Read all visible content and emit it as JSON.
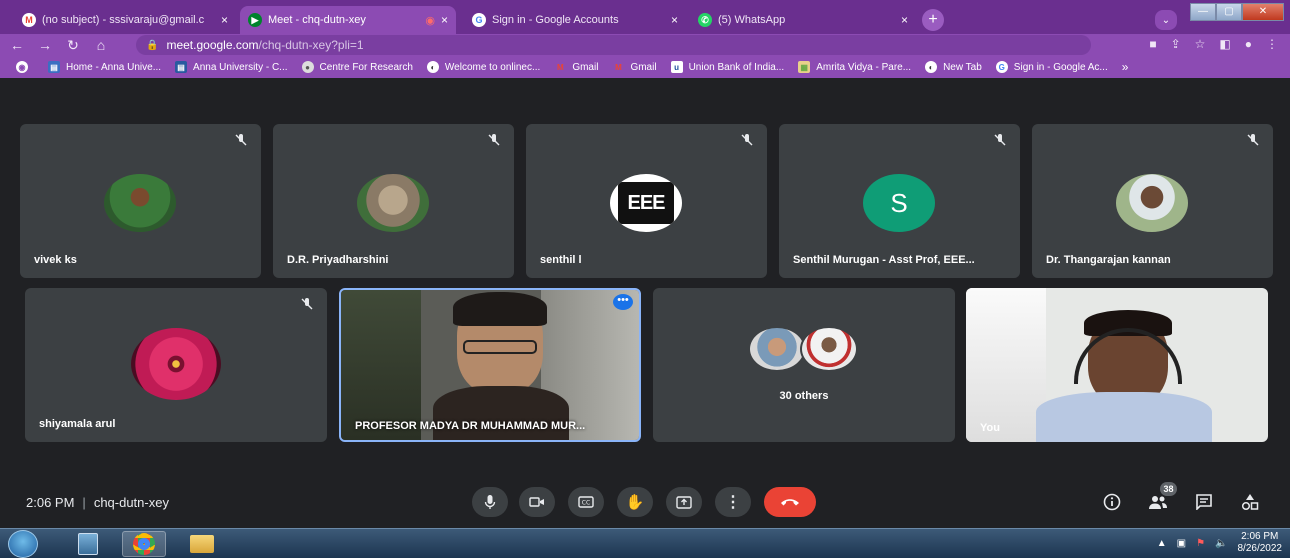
{
  "browser": {
    "tabs": [
      {
        "title": "(no subject) - sssivaraju@gmail.c",
        "favicon": "gmail-icon",
        "close": "×"
      },
      {
        "title": "Meet - chq-dutn-xey",
        "favicon": "meet-icon",
        "close": "×",
        "active": true,
        "recording": "◉"
      },
      {
        "title": "Sign in - Google Accounts",
        "favicon": "google-icon",
        "close": "×"
      },
      {
        "title": "(5) WhatsApp",
        "favicon": "whatsapp-icon",
        "close": "×"
      }
    ],
    "new_tab": "+",
    "url_host": "meet.google.com",
    "url_path": "/chq-dutn-xey?pli=1",
    "bookmarks": [
      "Home - Anna Unive...",
      "Anna University - C...",
      "Centre For Research",
      "Welcome to onlinec...",
      "Gmail",
      "Gmail",
      "Union Bank of India...",
      "Amrita Vidya - Pare...",
      "New Tab",
      "Sign in - Google Ac..."
    ],
    "bookmarks_more": "»"
  },
  "meet": {
    "participants_top": [
      {
        "name": "vivek ks"
      },
      {
        "name": "D.R. Priyadharshini"
      },
      {
        "name": "senthil l",
        "logo_text": "EEE"
      },
      {
        "name": "Senthil Murugan - Asst Prof, EEE...",
        "initial": "S"
      },
      {
        "name": "Dr. Thangarajan kannan"
      }
    ],
    "participants_bottom": [
      {
        "name": "shiyamala arul"
      },
      {
        "name": "PROFESOR MADYA DR MUHAMMAD MUR..."
      },
      {
        "name": "30 others"
      },
      {
        "name": "You"
      }
    ],
    "time": "2:06 PM",
    "separator": "|",
    "meeting_code": "chq-dutn-xey",
    "participant_count": "38",
    "colors": {
      "hangup": "#ea4335",
      "tile": "#3c4043",
      "background": "#202124",
      "speaking_border": "#8ab4f8",
      "avatar_s": "#0f9d76"
    }
  },
  "taskbar": {
    "clock_time": "2:06 PM",
    "clock_date": "8/26/2022"
  }
}
